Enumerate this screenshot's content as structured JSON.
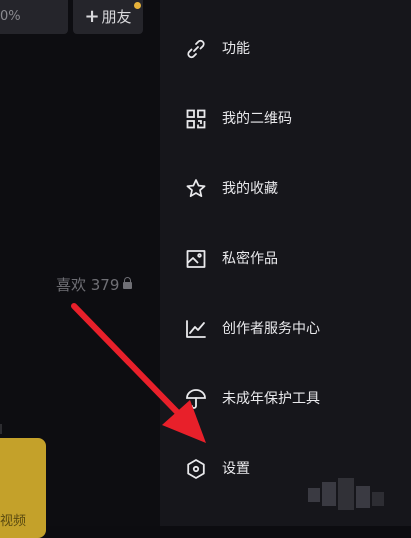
{
  "left": {
    "progress_text": "0%",
    "add_friend": {
      "plus": "+",
      "label": "朋友"
    },
    "likes_label": "喜欢 379",
    "video_label": "视频"
  },
  "drawer": {
    "items": [
      {
        "label": "功能",
        "icon": "link-icon"
      },
      {
        "label": "我的二维码",
        "icon": "qr-code-icon"
      },
      {
        "label": "我的收藏",
        "icon": "star-icon"
      },
      {
        "label": "私密作品",
        "icon": "image-icon"
      },
      {
        "label": "创作者服务中心",
        "icon": "chart-icon"
      },
      {
        "label": "未成年保护工具",
        "icon": "umbrella-icon"
      },
      {
        "label": "设置",
        "icon": "settings-hex-icon"
      }
    ]
  },
  "colors": {
    "drawer_bg": "#16161b",
    "arrow": "#e8202a",
    "accent_dot": "#e7b23a",
    "video_card": "#c4a12a"
  }
}
